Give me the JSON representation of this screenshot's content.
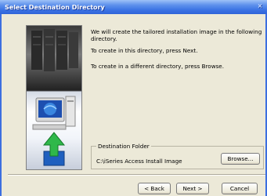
{
  "window": {
    "title": "Select Destination Directory",
    "close_glyph": "×"
  },
  "body": {
    "line1a": "We will create the tailored installation image in the following",
    "line1b": "directory.",
    "line2": "To create in this directory, press Next.",
    "line3": "To create in a different directory, press Browse."
  },
  "folder": {
    "legend": "Destination Folder",
    "path": "C:\\iSeries Access Install Image",
    "browse_label": "Browse..."
  },
  "buttons": {
    "back": "< Back",
    "next": "Next >",
    "cancel": "Cancel"
  },
  "colors": {
    "titlebar": "#3c74e4",
    "dialog_bg": "#ece9d8",
    "arrow_green": "#2fb84a"
  },
  "icons": [
    "close-icon",
    "computer-icon",
    "green-up-arrow-icon"
  ]
}
